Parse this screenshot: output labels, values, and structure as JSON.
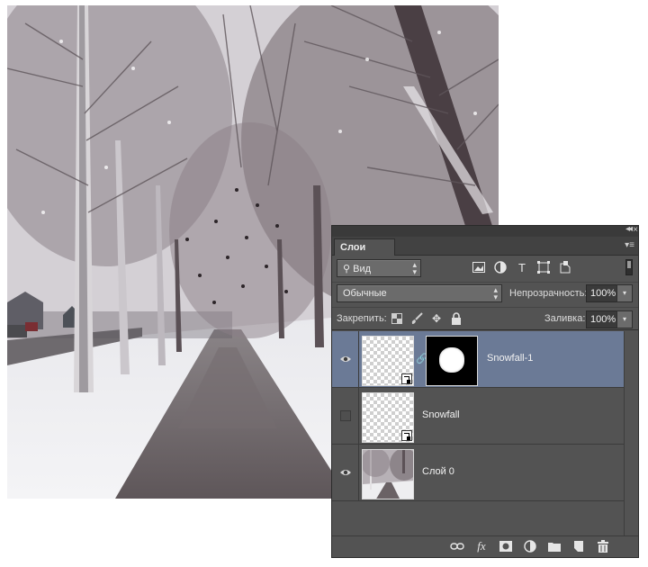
{
  "panel": {
    "tab_label": "Слои",
    "filter": {
      "kind_label": "Вид",
      "icons": [
        "image-filter-icon",
        "adjustment-filter-icon",
        "type-filter-icon",
        "shape-filter-icon",
        "smart-object-filter-icon"
      ]
    },
    "blend_mode": "Обычные",
    "opacity_label": "Непрозрачность:",
    "opacity_value": "100%",
    "lock_label": "Закрепить:",
    "fill_label": "Заливка:",
    "fill_value": "100%"
  },
  "layers": [
    {
      "name": "Snowfall-1",
      "visible": true,
      "selected": true,
      "smart_object": true,
      "has_mask": true
    },
    {
      "name": "Snowfall",
      "visible": false,
      "selected": false,
      "smart_object": true,
      "has_mask": false
    },
    {
      "name": "Слой 0",
      "visible": true,
      "selected": false,
      "smart_object": false,
      "has_mask": false
    }
  ],
  "bottom_icons": [
    "link-layers-icon",
    "fx-icon",
    "add-mask-icon",
    "adjustment-layer-icon",
    "new-group-icon",
    "new-layer-icon",
    "trash-icon"
  ],
  "colors": {
    "panel_bg": "#535353",
    "selected_layer": "#6b7a96"
  }
}
